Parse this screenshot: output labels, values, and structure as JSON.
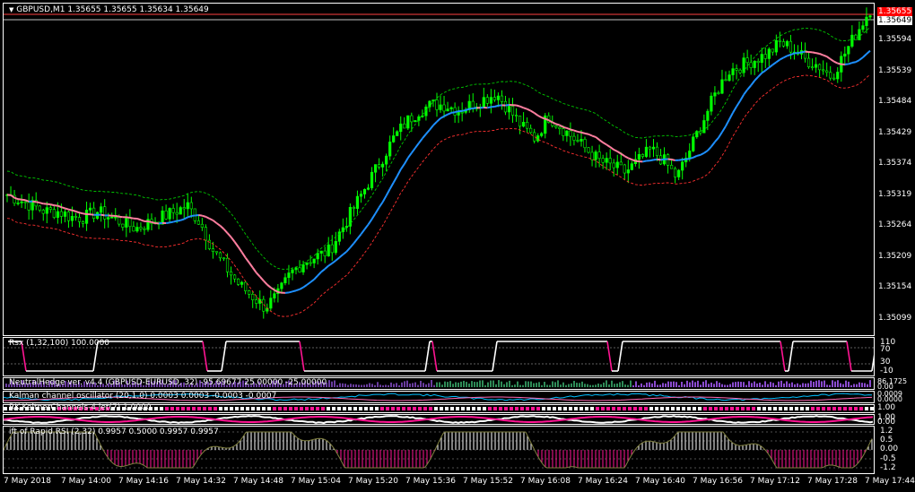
{
  "chart_header": {
    "symbol_label": "GBPUSD,M1",
    "ohlc": "1.35655 1.35655 1.35634 1.35649"
  },
  "price_axis": {
    "current_price": "1.35649",
    "ask_label": "1.35655",
    "levels": [
      "1.35594",
      "1.35539",
      "1.35484",
      "1.35429",
      "1.35374",
      "1.35319",
      "1.35264",
      "1.35209",
      "1.35154",
      "1.35099"
    ]
  },
  "indicators": {
    "rsx": {
      "title": "Rsx (1,32,100) 100.0000",
      "levels": [
        "110",
        "70",
        "30",
        "-10"
      ]
    },
    "neutral": {
      "title": "NeutralHedge ver. v4.4 (GBPUSD-EURUSD, 32) -95.69677 25.00000 -25.00000",
      "levels": [
        "86.1725",
        "0.00"
      ]
    },
    "kalman": {
      "title": "Kalman channel oscillator (20,1.0) 0.0003 0.0003 -0.0003 -0.0007",
      "levels": [
        "0.0009",
        "0.0000"
      ]
    },
    "keltner": {
      "title": "RK-KeltnerChannels-4 jet(7) 1.0000",
      "levels": [
        "1.00"
      ]
    },
    "row5": {
      "title": "...",
      "levels": [
        "1.00",
        "0.00"
      ]
    },
    "ift": {
      "title": "ift of Rapid RSI (2,32) 0.9957 0.5000 0.9957 0.9957",
      "levels": [
        "1.2",
        "0.5",
        "0.00",
        "-0.5",
        "-1.2"
      ]
    }
  },
  "time_axis": [
    "7 May 2018",
    "7 May 14:00",
    "7 May 14:16",
    "7 May 14:32",
    "7 May 14:48",
    "7 May 15:04",
    "7 May 15:20",
    "7 May 15:36",
    "7 May 15:52",
    "7 May 16:08",
    "7 May 16:24",
    "7 May 16:40",
    "7 May 16:56",
    "7 May 17:12",
    "7 May 17:28",
    "7 May 17:44"
  ],
  "colors": {
    "bull_candle": "#00ff00",
    "ma_up": "#1e90ff",
    "ma_down": "#ff7fa0",
    "upper_band": "#00c800",
    "lower_band": "#ff3030",
    "rsx_line": "#ffffff",
    "rsx_down": "#ff1493",
    "grid_level": "#c0c0c0"
  },
  "chart_data": {
    "type": "candlestick",
    "symbol": "GBPUSD",
    "timeframe": "M1",
    "ylim": [
      1.3507,
      1.3566
    ],
    "close_path": [
      1.3532,
      1.3531,
      1.353,
      1.3529,
      1.3529,
      1.3528,
      1.3528,
      1.3529,
      1.3528,
      1.3527,
      1.3526,
      1.3527,
      1.3528,
      1.3529,
      1.353,
      1.3527,
      1.3522,
      1.3519,
      1.3516,
      1.3514,
      1.3512,
      1.3514,
      1.3518,
      1.352,
      1.3521,
      1.3522,
      1.3526,
      1.353,
      1.3534,
      1.3538,
      1.3542,
      1.3545,
      1.3547,
      1.3548,
      1.3548,
      1.3547,
      1.3548,
      1.3549,
      1.355,
      1.3547,
      1.3544,
      1.3542,
      1.3546,
      1.3544,
      1.3542,
      1.354,
      1.3538,
      1.3537,
      1.3536,
      1.3538,
      1.354,
      1.3538,
      1.3535,
      1.354,
      1.3545,
      1.355,
      1.3554,
      1.3555,
      1.3556,
      1.3557,
      1.3559,
      1.3558,
      1.3556,
      1.3555,
      1.3553,
      1.3557,
      1.3561,
      1.3565
    ]
  }
}
